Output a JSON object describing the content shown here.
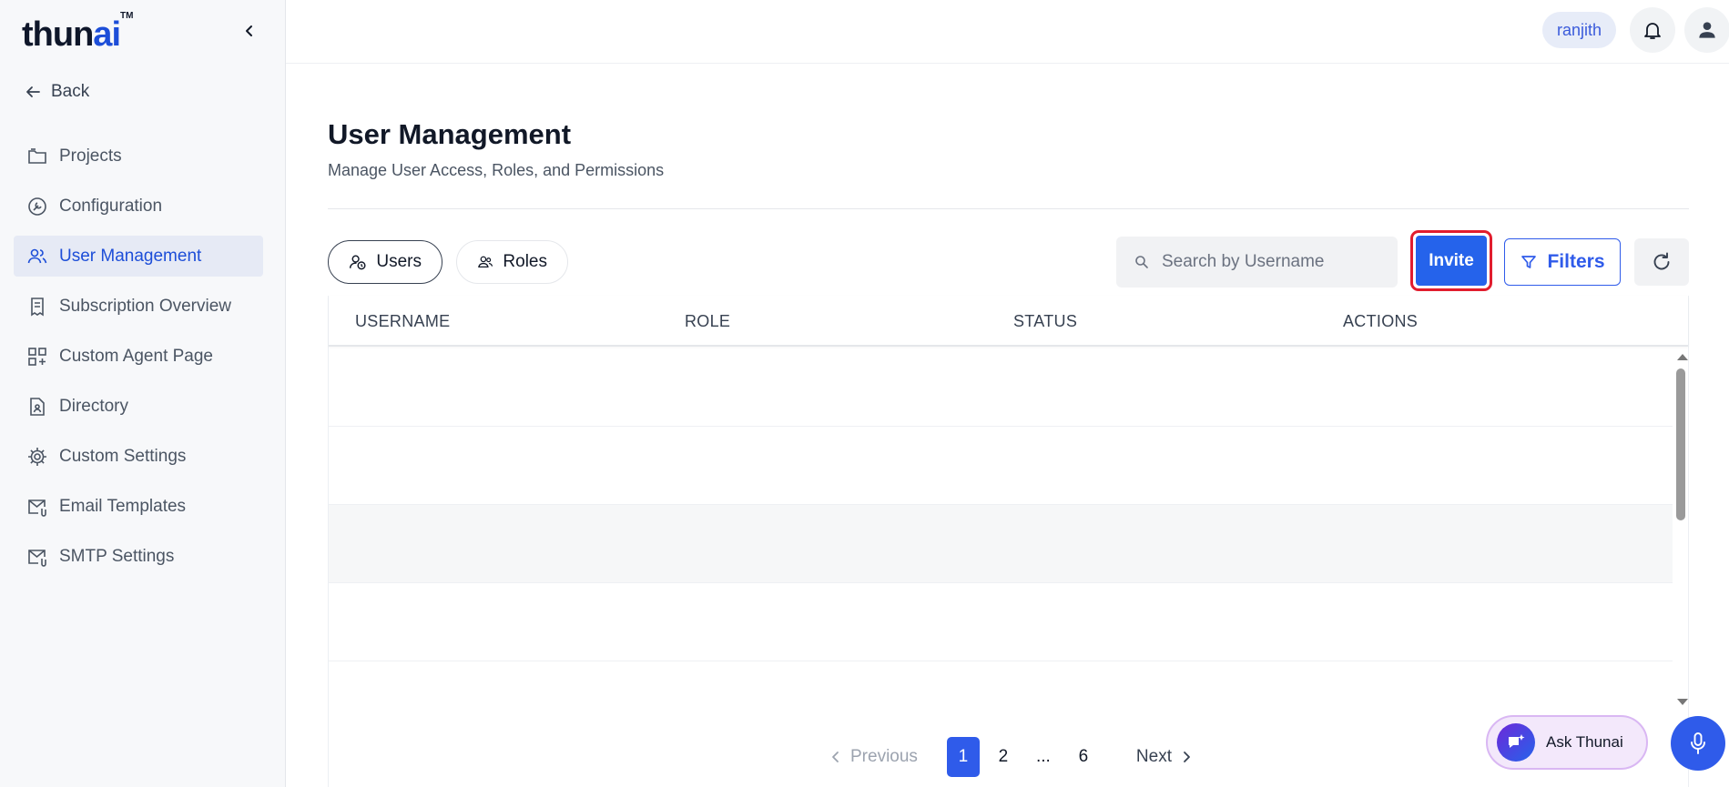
{
  "brand": {
    "logo_main": "thun",
    "logo_accent": "a",
    "logo_tail": "i",
    "trademark": "TM"
  },
  "sidebar": {
    "back_label": "Back",
    "items": [
      {
        "label": "Projects",
        "icon": "folder-icon",
        "active": false
      },
      {
        "label": "Configuration",
        "icon": "configuration-icon",
        "active": false
      },
      {
        "label": "User Management",
        "icon": "users-icon",
        "active": true
      },
      {
        "label": "Subscription Overview",
        "icon": "receipt-icon",
        "active": false
      },
      {
        "label": "Custom Agent Page",
        "icon": "grid-plus-icon",
        "active": false
      },
      {
        "label": "Directory",
        "icon": "contact-file-icon",
        "active": false
      },
      {
        "label": "Custom Settings",
        "icon": "gear-icon",
        "active": false
      },
      {
        "label": "Email Templates",
        "icon": "mail-clip-icon",
        "active": false
      },
      {
        "label": "SMTP Settings",
        "icon": "mail-clip-icon",
        "active": false
      }
    ]
  },
  "topbar": {
    "username": "ranjith",
    "icons": [
      "bell-icon",
      "user-icon"
    ]
  },
  "page": {
    "title": "User Management",
    "subtitle": "Manage User Access, Roles, and Permissions"
  },
  "tabs": [
    {
      "label": "Users",
      "icon": "user-clock-icon",
      "selected": true
    },
    {
      "label": "Roles",
      "icon": "people-icon",
      "selected": false
    }
  ],
  "toolbar": {
    "search_placeholder": "Search by Username",
    "search_value": "",
    "invite_label": "Invite",
    "filters_label": "Filters"
  },
  "table": {
    "columns": [
      "USERNAME",
      "ROLE",
      "STATUS",
      "ACTIONS"
    ],
    "rows": []
  },
  "pagination": {
    "previous_label": "Previous",
    "pages": [
      "1",
      "2",
      "...",
      "6"
    ],
    "current": "1",
    "next_label": "Next"
  },
  "assistant": {
    "label": "Ask Thunai"
  },
  "colors": {
    "accent": "#2f5bea",
    "active_nav_bg": "#e6eaf5",
    "highlight_border": "#e11d2e"
  }
}
